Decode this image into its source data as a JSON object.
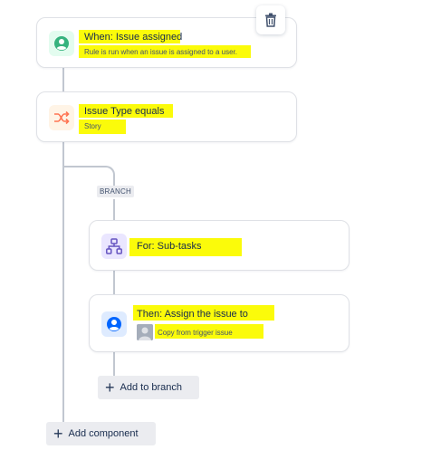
{
  "trigger": {
    "title": "When: Issue assigned",
    "subtitle": "Rule is run when an issue is assigned to a user."
  },
  "condition": {
    "title": "Issue Type equals",
    "subtitle": "Story"
  },
  "branch": {
    "label": "BRANCH",
    "for_title": "For: Sub-tasks",
    "action_title": "Then: Assign the issue to",
    "action_subtitle": "Copy from trigger issue",
    "add_label": "Add to branch"
  },
  "add_component_label": "Add component",
  "colors": {
    "highlight": "#fbfb0a",
    "trigger_icon": "#36b37e",
    "condition_icon": "#ff7452",
    "branch_icon": "#6554c0",
    "action_icon": "#0065ff"
  },
  "icons": {
    "trigger": "user-circle-icon",
    "condition": "shuffle-icon",
    "branch": "hierarchy-icon",
    "action": "user-circle-icon",
    "delete": "trash-icon"
  }
}
